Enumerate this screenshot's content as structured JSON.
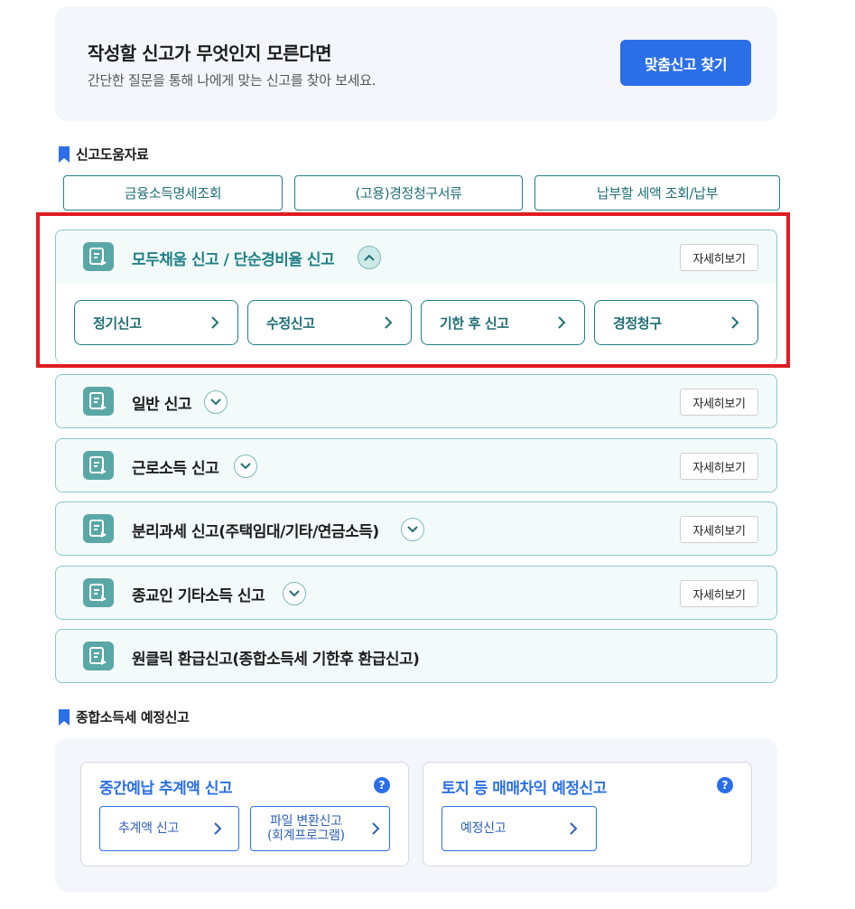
{
  "banner": {
    "title": "작성할 신고가 무엇인지 모른다면",
    "subtitle": "간단한 질문을 통해 나에게 맞는 신고를 찾아 보세요.",
    "button_label": "맞춤신고 찾기"
  },
  "help_section": {
    "heading": "신고도움자료",
    "buttons": [
      "금융소득명세조회",
      "(고용)경정청구서류",
      "납부할 세액 조회/납부"
    ]
  },
  "accordions": [
    {
      "title": "모두채움 신고 / 단순경비율 신고",
      "expanded": true,
      "detail_label": "자세히보기",
      "sub_buttons": [
        "정기신고",
        "수정신고",
        "기한 후 신고",
        "경정청구"
      ]
    },
    {
      "title": "일반 신고",
      "expanded": false,
      "detail_label": "자세히보기"
    },
    {
      "title": "근로소득 신고",
      "expanded": false,
      "detail_label": "자세히보기"
    },
    {
      "title": "분리과세 신고(주택임대/기타/연금소득)",
      "expanded": false,
      "detail_label": "자세히보기"
    },
    {
      "title": "종교인 기타소득 신고",
      "expanded": false,
      "detail_label": "자세히보기"
    },
    {
      "title": "원클릭 환급신고(종합소득세 기한후 환급신고)"
    }
  ],
  "estimate_section": {
    "heading": "종합소득세 예정신고",
    "cards": [
      {
        "title": "중간예납 추계액 신고",
        "help": "?",
        "buttons": [
          "추계액 신고",
          "파일 변환신고\n(회계프로그램)"
        ]
      },
      {
        "title": "토지 등 매매차익 예정신고",
        "help": "?",
        "buttons": [
          "예정신고"
        ]
      }
    ]
  },
  "colors": {
    "primary_blue": "#2b6fe8",
    "teal": "#1f7f86",
    "teal_icon": "#5aa7a7",
    "highlight_red": "#e11b22"
  },
  "icons": {
    "bookmark": "bookmark-icon",
    "document": "document-edit-icon",
    "chevron_right": "chevron-right-icon",
    "chevron_up": "chevron-up-icon",
    "chevron_down": "chevron-down-icon",
    "help": "question-circle-icon"
  }
}
